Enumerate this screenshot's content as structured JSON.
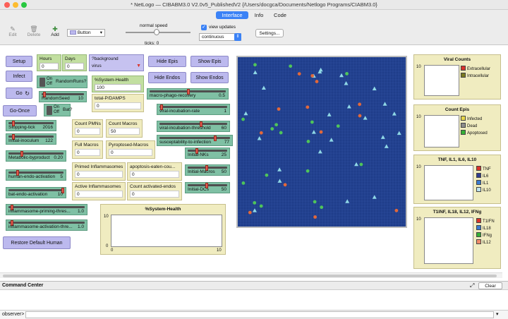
{
  "window": {
    "title": "* NetLogo — CIBABM3.0 V2.0v5_PublishedV2 {/Users/docgca/Documents/Netlogo Programs/CIABM3.0}"
  },
  "tabs": {
    "interface": "Interface",
    "info": "Info",
    "code": "Code"
  },
  "toolbar": {
    "edit": "Edit",
    "delete": "Delete",
    "add": "Add",
    "widget_type": "Button",
    "speed_label": "normal speed",
    "ticks_label": "ticks:",
    "ticks_value": "0",
    "view_updates": "view updates",
    "update_mode": "continuous",
    "settings": "Settings..."
  },
  "buttons": {
    "setup": "Setup",
    "infect": "Infect",
    "go": "Go",
    "go_once": "Go-Once",
    "hide_epis": "Hide Epis",
    "show_epis": "Show Epis",
    "hide_endos": "Hide Endos",
    "show_endos": "Show Endos",
    "restore": "Restore Default Human"
  },
  "inputs": {
    "hours_label": "Hours",
    "hours_value": "0",
    "days_label": "Days",
    "days_value": "0",
    "health_label": "%System-Health",
    "health_value": "100",
    "pamps_label": "total-P/DAMPS",
    "pamps_value": "0"
  },
  "chooser": {
    "label": "?background",
    "value": "virus"
  },
  "switches": {
    "randomruns_on": "On",
    "randomruns_off": "Off",
    "randomruns_label": "RandomRuns?",
    "bat_on": "On",
    "bat_off": "Off",
    "bat_label": "Bat?"
  },
  "sliders": [
    {
      "label": "RandomSeed",
      "value": "10"
    },
    {
      "label": "Stopping-tick",
      "value": "2016"
    },
    {
      "label": "Initial-inoculum",
      "value": "122"
    },
    {
      "label": "Metabolic-byproduct",
      "value": "0.20"
    },
    {
      "label": "human-endo-activation",
      "value": "5"
    },
    {
      "label": "bat-endo-activation",
      "value": "10"
    },
    {
      "label": "inflammasome-priming-thres...",
      "value": "1.0"
    },
    {
      "label": "inflammasome-activation-thre...",
      "value": "1.0"
    },
    {
      "label": "macro-phago-recovery",
      "value": "0.5"
    },
    {
      "label": "viral-incubation-rate",
      "value": "1"
    },
    {
      "label": "viral-incubation-threshold",
      "value": "60"
    },
    {
      "label": "susceptability-to-infection",
      "value": "77"
    },
    {
      "label": "Initial-NKs",
      "value": "25"
    },
    {
      "label": "Initial-Macros",
      "value": "50"
    },
    {
      "label": "Initial-DCs",
      "value": "50"
    }
  ],
  "monitors": [
    {
      "label": "Count PMNs",
      "value": "0"
    },
    {
      "label": "Count Macros",
      "value": "50"
    },
    {
      "label": "Full Macros",
      "value": "0"
    },
    {
      "label": "Pyroptosed-Macros",
      "value": "0"
    },
    {
      "label": "Primed Inflammasomes",
      "value": "0"
    },
    {
      "label": "apoptosis-eaten-cou...",
      "value": "0"
    },
    {
      "label": "Active Inflammasomes",
      "value": "0"
    },
    {
      "label": "Count activated-endos",
      "value": "0"
    }
  ],
  "health_plot": {
    "title": "%System-Health",
    "y_max": "10",
    "y_min": "0",
    "x_min": "0",
    "x_max": "10"
  },
  "plots": [
    {
      "title": "Viral Counts",
      "y_max": "10",
      "legend": [
        {
          "label": "Extracellular",
          "color": "#d9342b"
        },
        {
          "label": "Intracellular",
          "color": "#7a7a20"
        }
      ]
    },
    {
      "title": "Count Epis",
      "y_max": "10",
      "legend": [
        {
          "label": "Infected",
          "color": "#e6d64a"
        },
        {
          "label": "Dead",
          "color": "#8c8c8c"
        },
        {
          "label": "Apoptosed",
          "color": "#35b035"
        }
      ]
    },
    {
      "title": "TNF, IL1, IL6, IL10",
      "y_max": "10",
      "legend": [
        {
          "label": "TNF",
          "color": "#d9342b"
        },
        {
          "label": "IL6",
          "color": "#2f3c8f"
        },
        {
          "label": "IL1",
          "color": "#3b7bd1"
        },
        {
          "label": "IL10",
          "color": "#bfe3f0"
        }
      ]
    },
    {
      "title": "T1INF, IL18, IL12, IFNg",
      "y_max": "10",
      "legend": [
        {
          "label": "T1IFN",
          "color": "#d9342b"
        },
        {
          "label": "IL18",
          "color": "#3b7bd1"
        },
        {
          "label": "IFNg",
          "color": "#35b035"
        },
        {
          "label": "IL12",
          "color": "#f08c6a"
        }
      ]
    }
  ],
  "command_center": {
    "title": "Command Center",
    "clear": "Clear",
    "prompt": "observer>"
  },
  "colors": {
    "button": "#bcb9ee",
    "slider": "#7fc0a4",
    "monitor": "#f0ecc0",
    "input": "#c2dfa0",
    "world": "#1f3d8a"
  }
}
